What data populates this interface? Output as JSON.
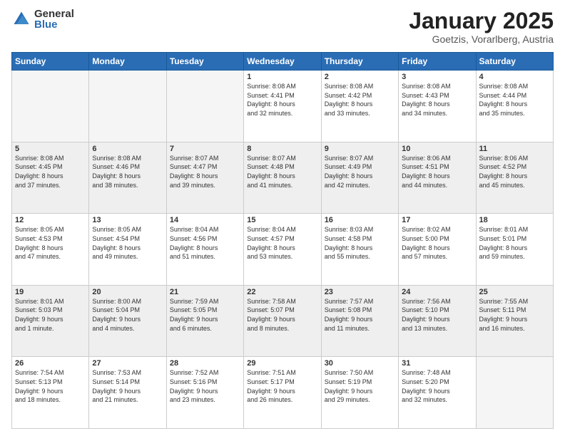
{
  "logo": {
    "general": "General",
    "blue": "Blue"
  },
  "header": {
    "month": "January 2025",
    "location": "Goetzis, Vorarlberg, Austria"
  },
  "days_of_week": [
    "Sunday",
    "Monday",
    "Tuesday",
    "Wednesday",
    "Thursday",
    "Friday",
    "Saturday"
  ],
  "weeks": [
    {
      "shaded": false,
      "days": [
        {
          "num": "",
          "info": ""
        },
        {
          "num": "",
          "info": ""
        },
        {
          "num": "",
          "info": ""
        },
        {
          "num": "1",
          "info": "Sunrise: 8:08 AM\nSunset: 4:41 PM\nDaylight: 8 hours\nand 32 minutes."
        },
        {
          "num": "2",
          "info": "Sunrise: 8:08 AM\nSunset: 4:42 PM\nDaylight: 8 hours\nand 33 minutes."
        },
        {
          "num": "3",
          "info": "Sunrise: 8:08 AM\nSunset: 4:43 PM\nDaylight: 8 hours\nand 34 minutes."
        },
        {
          "num": "4",
          "info": "Sunrise: 8:08 AM\nSunset: 4:44 PM\nDaylight: 8 hours\nand 35 minutes."
        }
      ]
    },
    {
      "shaded": true,
      "days": [
        {
          "num": "5",
          "info": "Sunrise: 8:08 AM\nSunset: 4:45 PM\nDaylight: 8 hours\nand 37 minutes."
        },
        {
          "num": "6",
          "info": "Sunrise: 8:08 AM\nSunset: 4:46 PM\nDaylight: 8 hours\nand 38 minutes."
        },
        {
          "num": "7",
          "info": "Sunrise: 8:07 AM\nSunset: 4:47 PM\nDaylight: 8 hours\nand 39 minutes."
        },
        {
          "num": "8",
          "info": "Sunrise: 8:07 AM\nSunset: 4:48 PM\nDaylight: 8 hours\nand 41 minutes."
        },
        {
          "num": "9",
          "info": "Sunrise: 8:07 AM\nSunset: 4:49 PM\nDaylight: 8 hours\nand 42 minutes."
        },
        {
          "num": "10",
          "info": "Sunrise: 8:06 AM\nSunset: 4:51 PM\nDaylight: 8 hours\nand 44 minutes."
        },
        {
          "num": "11",
          "info": "Sunrise: 8:06 AM\nSunset: 4:52 PM\nDaylight: 8 hours\nand 45 minutes."
        }
      ]
    },
    {
      "shaded": false,
      "days": [
        {
          "num": "12",
          "info": "Sunrise: 8:05 AM\nSunset: 4:53 PM\nDaylight: 8 hours\nand 47 minutes."
        },
        {
          "num": "13",
          "info": "Sunrise: 8:05 AM\nSunset: 4:54 PM\nDaylight: 8 hours\nand 49 minutes."
        },
        {
          "num": "14",
          "info": "Sunrise: 8:04 AM\nSunset: 4:56 PM\nDaylight: 8 hours\nand 51 minutes."
        },
        {
          "num": "15",
          "info": "Sunrise: 8:04 AM\nSunset: 4:57 PM\nDaylight: 8 hours\nand 53 minutes."
        },
        {
          "num": "16",
          "info": "Sunrise: 8:03 AM\nSunset: 4:58 PM\nDaylight: 8 hours\nand 55 minutes."
        },
        {
          "num": "17",
          "info": "Sunrise: 8:02 AM\nSunset: 5:00 PM\nDaylight: 8 hours\nand 57 minutes."
        },
        {
          "num": "18",
          "info": "Sunrise: 8:01 AM\nSunset: 5:01 PM\nDaylight: 8 hours\nand 59 minutes."
        }
      ]
    },
    {
      "shaded": true,
      "days": [
        {
          "num": "19",
          "info": "Sunrise: 8:01 AM\nSunset: 5:03 PM\nDaylight: 9 hours\nand 1 minute."
        },
        {
          "num": "20",
          "info": "Sunrise: 8:00 AM\nSunset: 5:04 PM\nDaylight: 9 hours\nand 4 minutes."
        },
        {
          "num": "21",
          "info": "Sunrise: 7:59 AM\nSunset: 5:05 PM\nDaylight: 9 hours\nand 6 minutes."
        },
        {
          "num": "22",
          "info": "Sunrise: 7:58 AM\nSunset: 5:07 PM\nDaylight: 9 hours\nand 8 minutes."
        },
        {
          "num": "23",
          "info": "Sunrise: 7:57 AM\nSunset: 5:08 PM\nDaylight: 9 hours\nand 11 minutes."
        },
        {
          "num": "24",
          "info": "Sunrise: 7:56 AM\nSunset: 5:10 PM\nDaylight: 9 hours\nand 13 minutes."
        },
        {
          "num": "25",
          "info": "Sunrise: 7:55 AM\nSunset: 5:11 PM\nDaylight: 9 hours\nand 16 minutes."
        }
      ]
    },
    {
      "shaded": false,
      "days": [
        {
          "num": "26",
          "info": "Sunrise: 7:54 AM\nSunset: 5:13 PM\nDaylight: 9 hours\nand 18 minutes."
        },
        {
          "num": "27",
          "info": "Sunrise: 7:53 AM\nSunset: 5:14 PM\nDaylight: 9 hours\nand 21 minutes."
        },
        {
          "num": "28",
          "info": "Sunrise: 7:52 AM\nSunset: 5:16 PM\nDaylight: 9 hours\nand 23 minutes."
        },
        {
          "num": "29",
          "info": "Sunrise: 7:51 AM\nSunset: 5:17 PM\nDaylight: 9 hours\nand 26 minutes."
        },
        {
          "num": "30",
          "info": "Sunrise: 7:50 AM\nSunset: 5:19 PM\nDaylight: 9 hours\nand 29 minutes."
        },
        {
          "num": "31",
          "info": "Sunrise: 7:48 AM\nSunset: 5:20 PM\nDaylight: 9 hours\nand 32 minutes."
        },
        {
          "num": "",
          "info": ""
        }
      ]
    }
  ]
}
